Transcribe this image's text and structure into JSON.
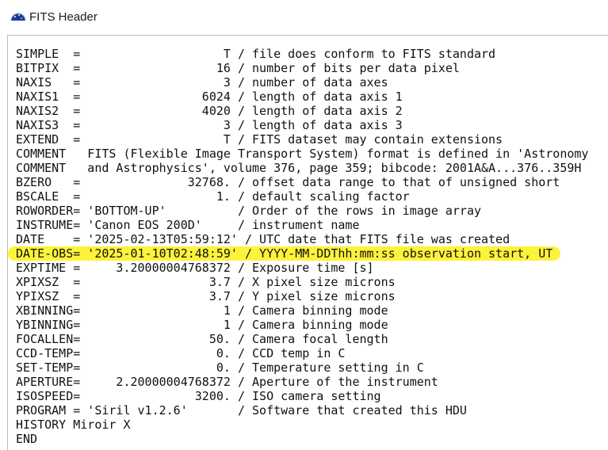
{
  "window": {
    "title": "FITS Header",
    "icon": "fits-app-icon"
  },
  "header_lines": [
    "SIMPLE  =                    T / file does conform to FITS standard",
    "BITPIX  =                   16 / number of bits per data pixel",
    "NAXIS   =                    3 / number of data axes",
    "NAXIS1  =                 6024 / length of data axis 1",
    "NAXIS2  =                 4020 / length of data axis 2",
    "NAXIS3  =                    3 / length of data axis 3",
    "EXTEND  =                    T / FITS dataset may contain extensions",
    "COMMENT   FITS (Flexible Image Transport System) format is defined in 'Astronomy",
    "COMMENT   and Astrophysics', volume 376, page 359; bibcode: 2001A&A...376..359H",
    "BZERO   =               32768. / offset data range to that of unsigned short",
    "BSCALE  =                   1. / default scaling factor",
    "ROWORDER= 'BOTTOM-UP'          / Order of the rows in image array",
    "INSTRUME= 'Canon EOS 200D'     / instrument name",
    "DATE    = '2025-02-13T05:59:12' / UTC date that FITS file was created",
    "DATE-OBS= '2025-01-10T02:48:59' / YYYY-MM-DDThh:mm:ss observation start, UT",
    "EXPTIME =     3.20000004768372 / Exposure time [s]",
    "XPIXSZ  =                  3.7 / X pixel size microns",
    "YPIXSZ  =                  3.7 / Y pixel size microns",
    "XBINNING=                    1 / Camera binning mode",
    "YBINNING=                    1 / Camera binning mode",
    "FOCALLEN=                  50. / Camera focal length",
    "CCD-TEMP=                   0. / CCD temp in C",
    "SET-TEMP=                   0. / Temperature setting in C",
    "APERTURE=     2.20000004768372 / Aperture of the instrument",
    "ISOSPEED=                3200. / ISO camera setting",
    "PROGRAM = 'Siril v1.2.6'       / Software that created this HDU",
    "HISTORY Miroir X",
    "END"
  ],
  "highlight": {
    "line_index": 14,
    "color": "#fdf33a"
  }
}
